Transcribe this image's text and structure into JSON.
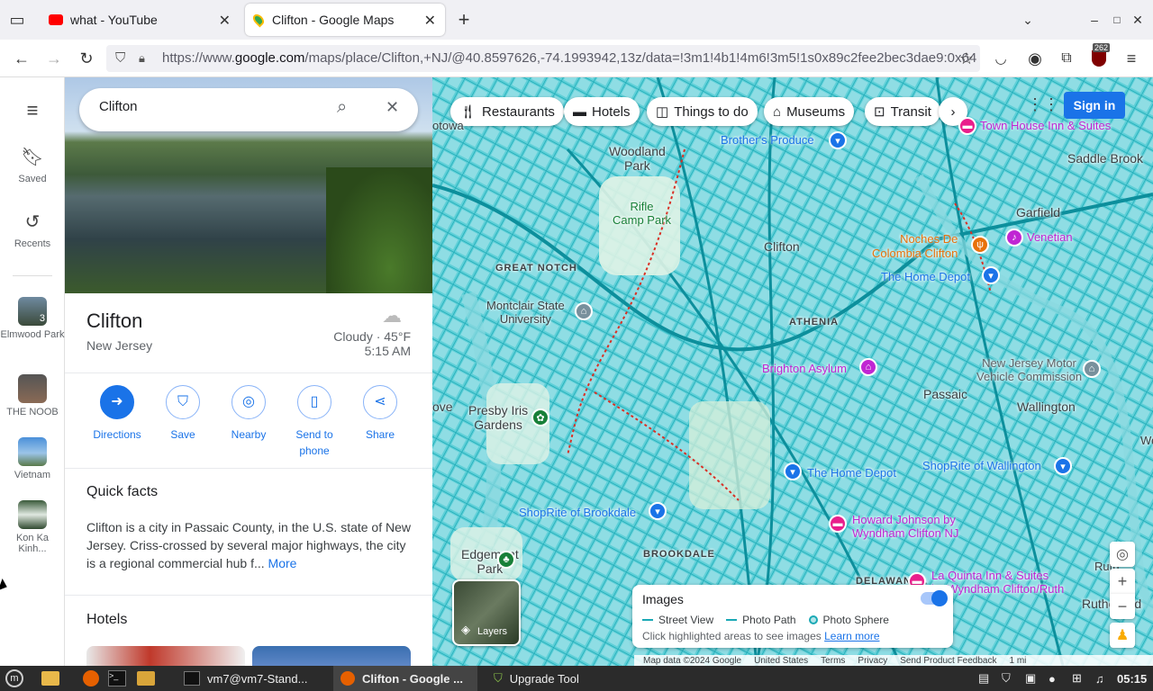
{
  "browser": {
    "tabs": [
      {
        "title": "what - YouTube"
      },
      {
        "title": "Clifton - Google Maps"
      }
    ],
    "url_prefix": "https://www.",
    "url_domain": "google.com",
    "url_rest": "/maps/place/Clifton,+NJ/@40.8597626,-74.1993942,13z/data=!3m1!4b1!4m6!3m5!1s0x89c2fee2bec3dae9:0x64",
    "extension_badge": "262"
  },
  "rail": {
    "saved": "Saved",
    "recents": "Recents",
    "history": [
      {
        "label": "Elmwood Park",
        "badge": "3"
      },
      {
        "label": "THE NOOB"
      },
      {
        "label": "Vietnam"
      },
      {
        "label": "Kon Ka Kinh..."
      }
    ]
  },
  "panel": {
    "search_value": "Clifton",
    "place_name": "Clifton",
    "place_region": "New Jersey",
    "weather": "Cloudy · 45°F",
    "time": "5:15 AM",
    "actions": [
      {
        "label": "Directions"
      },
      {
        "label": "Save"
      },
      {
        "label": "Nearby"
      },
      {
        "label": "Send to phone"
      },
      {
        "label": "Share"
      }
    ],
    "quick_facts_title": "Quick facts",
    "quick_facts_text": "Clifton is a city in Passaic County, in the U.S. state of New Jersey. Criss-crossed by several major highways, the city is a regional commercial hub f...",
    "more_link": "More",
    "hotels_title": "Hotels"
  },
  "map": {
    "chips": [
      "Restaurants",
      "Hotels",
      "Things to do",
      "Museums",
      "Transit"
    ],
    "sign_in": "Sign in",
    "labels": {
      "clifton": "Clifton",
      "passaic": "Passaic",
      "garfield": "Garfield",
      "saddle_brook": "Saddle Brook",
      "wallington": "Wallington",
      "athenia": "ATHENIA",
      "great_notch": "GREAT NOTCH",
      "brookdale": "BROOKDALE",
      "delawanna": "DELAWANNA",
      "rutherford": "Rutherford",
      "woodland_park": "Woodland\nPark",
      "rifle_camp": "Rifle\nCamp Park",
      "presby": "Presby Iris\nGardens",
      "edgemont": "Edgemont\nPark",
      "montclair": "Montclair State\nUniversity",
      "totowa": "otowa",
      "grove": "ove",
      "rutherford_e": "Ruth",
      "we": "We"
    },
    "pois": {
      "town_house": "Town House Inn & Suites",
      "brothers": "Brother's Produce",
      "noches": "Noches De\nColombia Clifton",
      "venetian": "Venetian",
      "home_depot1": "The Home Depot",
      "home_depot2": "The Home Depot",
      "brighton": "Brighton Asylum",
      "nj_motor": "New Jersey Motor\nVehicle Commission",
      "shoprite_w": "ShopRite of Wallington",
      "shoprite_b": "ShopRite of Brookdale",
      "howard": "Howard Johnson by\nWyndham Clifton NJ",
      "la_quinta": "La Quinta Inn & Suites\nby Wyndham Clifton/Ruth"
    },
    "images_card": {
      "title": "Images",
      "street_view": "Street View",
      "photo_path": "Photo Path",
      "photo_sphere": "Photo Sphere",
      "hint": "Click highlighted areas to see images",
      "learn_more": "Learn more"
    },
    "layers": "Layers",
    "footer": [
      "Map data ©2024 Google",
      "United States",
      "Terms",
      "Privacy",
      "Send Product Feedback",
      "1 mi"
    ]
  },
  "taskbar": {
    "items": [
      "vm7@vm7-Stand...",
      "Clifton - Google ...",
      "Upgrade Tool"
    ],
    "clock": "05:15"
  }
}
